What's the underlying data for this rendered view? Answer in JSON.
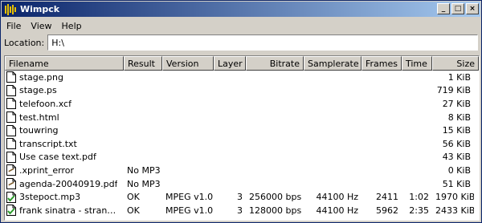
{
  "window": {
    "title": "Wimpck"
  },
  "title_buttons": {
    "minimize": "_",
    "maximize": "□",
    "close": "×"
  },
  "menu": {
    "items": [
      "File",
      "View",
      "Help"
    ]
  },
  "location": {
    "label": "Location:",
    "value": "H:\\"
  },
  "columns": [
    "Filename",
    "Result",
    "Version",
    "Layer",
    "Bitrate",
    "Samplerate",
    "Frames",
    "Time",
    "Size"
  ],
  "files": [
    {
      "icon": "document-icon",
      "name": "stage.png",
      "result": "",
      "version": "",
      "layer": "",
      "bitrate": "",
      "samplerate": "",
      "frames": "",
      "time": "",
      "size": "1 KiB"
    },
    {
      "icon": "document-icon",
      "name": "stage.ps",
      "result": "",
      "version": "",
      "layer": "",
      "bitrate": "",
      "samplerate": "",
      "frames": "",
      "time": "",
      "size": "719 KiB"
    },
    {
      "icon": "document-icon",
      "name": "telefoon.xcf",
      "result": "",
      "version": "",
      "layer": "",
      "bitrate": "",
      "samplerate": "",
      "frames": "",
      "time": "",
      "size": "27 KiB"
    },
    {
      "icon": "document-icon",
      "name": "test.html",
      "result": "",
      "version": "",
      "layer": "",
      "bitrate": "",
      "samplerate": "",
      "frames": "",
      "time": "",
      "size": "8 KiB"
    },
    {
      "icon": "document-icon",
      "name": "touwring",
      "result": "",
      "version": "",
      "layer": "",
      "bitrate": "",
      "samplerate": "",
      "frames": "",
      "time": "",
      "size": "15 KiB"
    },
    {
      "icon": "document-icon",
      "name": "transcript.txt",
      "result": "",
      "version": "",
      "layer": "",
      "bitrate": "",
      "samplerate": "",
      "frames": "",
      "time": "",
      "size": "56 KiB"
    },
    {
      "icon": "document-icon",
      "name": "Use case text.pdf",
      "result": "",
      "version": "",
      "layer": "",
      "bitrate": "",
      "samplerate": "",
      "frames": "",
      "time": "",
      "size": "43 KiB"
    },
    {
      "icon": "error-file-icon",
      "name": ".xprint_error",
      "result": "No MP3",
      "version": "",
      "layer": "",
      "bitrate": "",
      "samplerate": "",
      "frames": "",
      "time": "",
      "size": "0 KiB"
    },
    {
      "icon": "error-file-icon",
      "name": "agenda-20040919.pdf",
      "result": "No MP3",
      "version": "",
      "layer": "",
      "bitrate": "",
      "samplerate": "",
      "frames": "",
      "time": "",
      "size": "51 KiB"
    },
    {
      "icon": "ok-file-icon",
      "name": "3stepoct.mp3",
      "result": "OK",
      "version": "MPEG v1.0",
      "layer": "3",
      "bitrate": "256000 bps",
      "samplerate": "44100 Hz",
      "frames": "2411",
      "time": "1:02",
      "size": "1970 KiB"
    },
    {
      "icon": "ok-file-icon",
      "name": "frank sinatra - stranger...",
      "result": "OK",
      "version": "MPEG v1.0",
      "layer": "3",
      "bitrate": "128000 bps",
      "samplerate": "44100 Hz",
      "frames": "5962",
      "time": "2:35",
      "size": "2433 KiB"
    }
  ]
}
